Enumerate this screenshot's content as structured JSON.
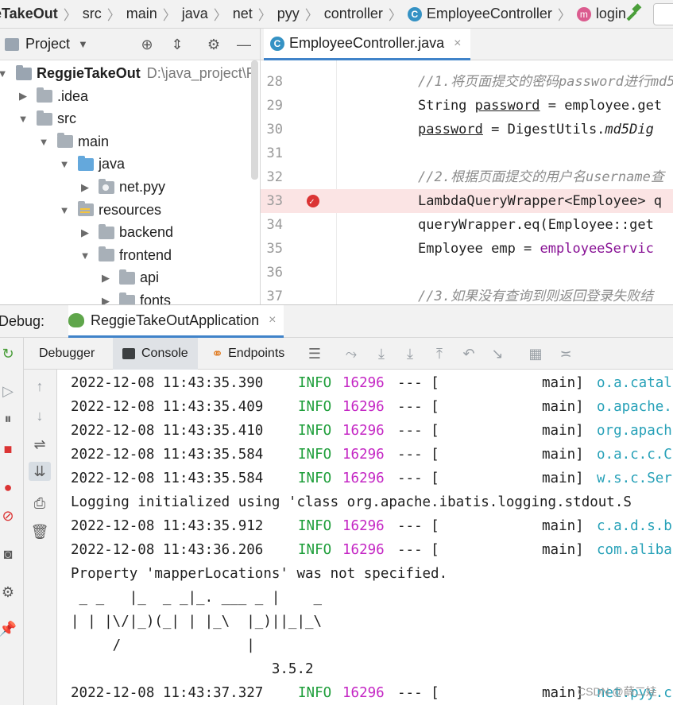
{
  "breadcrumb": {
    "items": [
      "eTakeOut",
      "src",
      "main",
      "java",
      "net",
      "pyy",
      "controller",
      "EmployeeController",
      "login"
    ]
  },
  "project": {
    "header": "Project",
    "tree": [
      {
        "label": "ReggieTakeOut",
        "path": "D:\\java_project\\R",
        "depth": 0,
        "arrow": "▼",
        "kind": "project"
      },
      {
        "label": ".idea",
        "depth": 1,
        "arrow": "▶",
        "kind": "folder"
      },
      {
        "label": "src",
        "depth": 1,
        "arrow": "▼",
        "kind": "folder"
      },
      {
        "label": "main",
        "depth": 2,
        "arrow": "▼",
        "kind": "folder"
      },
      {
        "label": "java",
        "depth": 3,
        "arrow": "▼",
        "kind": "blue"
      },
      {
        "label": "net.pyy",
        "depth": 4,
        "arrow": "▶",
        "kind": "pkg"
      },
      {
        "label": "resources",
        "depth": 3,
        "arrow": "▼",
        "kind": "res"
      },
      {
        "label": "backend",
        "depth": 4,
        "arrow": "▶",
        "kind": "folder"
      },
      {
        "label": "frontend",
        "depth": 4,
        "arrow": "▼",
        "kind": "folder"
      },
      {
        "label": "api",
        "depth": 5,
        "arrow": "▶",
        "kind": "folder"
      },
      {
        "label": "fonts",
        "depth": 5,
        "arrow": "▶",
        "kind": "folder"
      }
    ]
  },
  "editor": {
    "tab": "EmployeeController.java",
    "lines": [
      {
        "n": "28",
        "text": "//1.将页面提交的密码password进行md5",
        "kind": "comment"
      },
      {
        "n": "29",
        "pre": "String ",
        "ul": "password",
        "post": " = employee.get",
        "kind": "mixed"
      },
      {
        "n": "30",
        "pre": "",
        "ul": "password",
        "post": " = DigestUtils.",
        "ital": "md5Dig",
        "kind": "mixed2"
      },
      {
        "n": "31",
        "text": "",
        "kind": "plain"
      },
      {
        "n": "32",
        "text": "//2.根据页面提交的用户名username查",
        "kind": "comment"
      },
      {
        "n": "33",
        "text": "LambdaQueryWrapper<Employee> q",
        "kind": "highlight"
      },
      {
        "n": "34",
        "text": "queryWrapper.eq(Employee::get",
        "kind": "plain"
      },
      {
        "n": "35",
        "pre": "Employee emp = ",
        "purple": "employeeServic",
        "kind": "purple"
      },
      {
        "n": "36",
        "text": "",
        "kind": "plain"
      },
      {
        "n": "37",
        "text": "//3.如果没有查询到则返回登录失败结",
        "kind": "comment"
      }
    ]
  },
  "debug": {
    "label": "Debug:",
    "run_config": "ReggieTakeOutApplication",
    "tabs": {
      "debugger": "Debugger",
      "console": "Console",
      "endpoints": "Endpoints"
    }
  },
  "console": {
    "lines": [
      {
        "type": "log",
        "ts": "2022-12-08 11:43:35.390",
        "level": "INFO",
        "pid": "16296",
        "sep": "--- [",
        "thread": "main]",
        "logger": "o.a.catal"
      },
      {
        "type": "log",
        "ts": "2022-12-08 11:43:35.409",
        "level": "INFO",
        "pid": "16296",
        "sep": "--- [",
        "thread": "main]",
        "logger": "o.apache."
      },
      {
        "type": "log",
        "ts": "2022-12-08 11:43:35.410",
        "level": "INFO",
        "pid": "16296",
        "sep": "--- [",
        "thread": "main]",
        "logger": "org.apach"
      },
      {
        "type": "log",
        "ts": "2022-12-08 11:43:35.584",
        "level": "INFO",
        "pid": "16296",
        "sep": "--- [",
        "thread": "main]",
        "logger": "o.a.c.c.C"
      },
      {
        "type": "log",
        "ts": "2022-12-08 11:43:35.584",
        "level": "INFO",
        "pid": "16296",
        "sep": "--- [",
        "thread": "main]",
        "logger": "w.s.c.Ser"
      },
      {
        "type": "text",
        "text": "Logging initialized using 'class org.apache.ibatis.logging.stdout.S"
      },
      {
        "type": "log",
        "ts": "2022-12-08 11:43:35.912",
        "level": "INFO",
        "pid": "16296",
        "sep": "--- [",
        "thread": "main]",
        "logger": "c.a.d.s.b"
      },
      {
        "type": "log",
        "ts": "2022-12-08 11:43:36.206",
        "level": "INFO",
        "pid": "16296",
        "sep": "--- [",
        "thread": "main]",
        "logger": "com.aliba"
      },
      {
        "type": "text",
        "text": "Property 'mapperLocations' was not specified."
      },
      {
        "type": "text",
        "text": " _ _   |_  _ _|_. ___ _ |    _"
      },
      {
        "type": "text",
        "text": "| | |\\/|_)(_| | |_\\  |_)||_|_\\"
      },
      {
        "type": "text",
        "text": "     /               |"
      },
      {
        "type": "text",
        "text": "                        3.5.2"
      },
      {
        "type": "log",
        "ts": "2022-12-08 11:43:37.327",
        "level": "INFO",
        "pid": "16296",
        "sep": "--- [",
        "thread": "main]",
        "logger": "net.pyy.c"
      }
    ]
  },
  "watermark": "CSDN @薛二娃"
}
